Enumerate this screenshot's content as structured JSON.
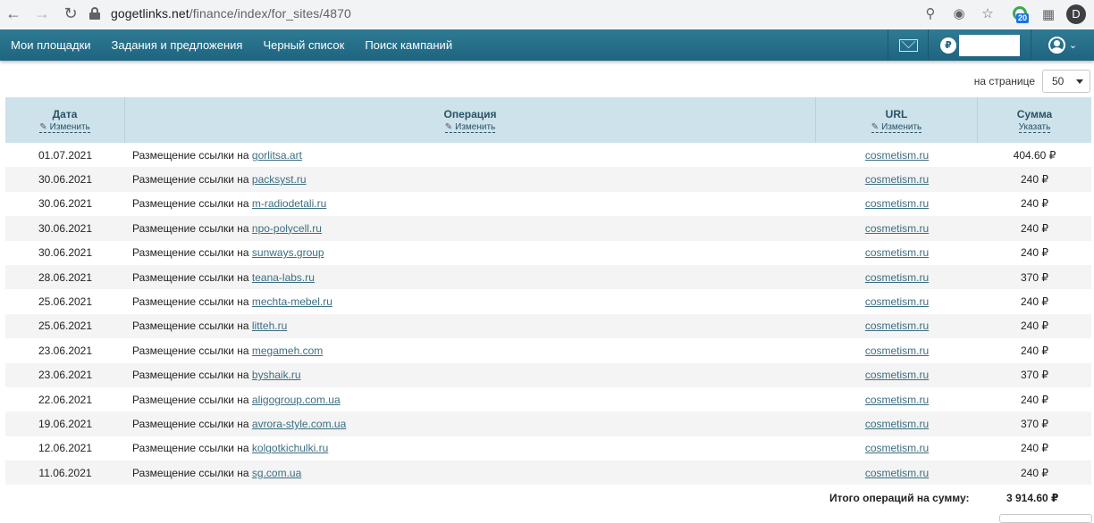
{
  "browser": {
    "url_host": "gogetlinks.net",
    "url_path": "/finance/index/for_sites/4870",
    "extension_badge": "20",
    "profile_initial": "D"
  },
  "nav": {
    "items": [
      "Мои площадки",
      "Задания и предложения",
      "Черный список",
      "Поиск кампаний"
    ],
    "currency_symbol": "₽"
  },
  "per_page": {
    "label": "на странице",
    "value": "50"
  },
  "table": {
    "headers": {
      "date": "Дата",
      "date_sub": "Изменить",
      "operation": "Операция",
      "operation_sub": "Изменить",
      "url": "URL",
      "url_sub": "Изменить",
      "sum": "Сумма",
      "sum_sub": "Указать"
    },
    "op_prefix": "Размещение ссылки на",
    "rows": [
      {
        "date": "01.07.2021",
        "site": "gorlitsa.art",
        "url": "cosmetism.ru",
        "sum": "404.60 ₽"
      },
      {
        "date": "30.06.2021",
        "site": "packsyst.ru",
        "url": "cosmetism.ru",
        "sum": "240 ₽"
      },
      {
        "date": "30.06.2021",
        "site": "m-radiodetali.ru",
        "url": "cosmetism.ru",
        "sum": "240 ₽"
      },
      {
        "date": "30.06.2021",
        "site": "npo-polycell.ru",
        "url": "cosmetism.ru",
        "sum": "240 ₽"
      },
      {
        "date": "30.06.2021",
        "site": "sunways.group",
        "url": "cosmetism.ru",
        "sum": "240 ₽"
      },
      {
        "date": "28.06.2021",
        "site": "teana-labs.ru",
        "url": "cosmetism.ru",
        "sum": "370 ₽"
      },
      {
        "date": "25.06.2021",
        "site": "mechta-mebel.ru",
        "url": "cosmetism.ru",
        "sum": "240 ₽"
      },
      {
        "date": "25.06.2021",
        "site": "litteh.ru",
        "url": "cosmetism.ru",
        "sum": "240 ₽"
      },
      {
        "date": "23.06.2021",
        "site": "megameh.com",
        "url": "cosmetism.ru",
        "sum": "240 ₽"
      },
      {
        "date": "23.06.2021",
        "site": "byshaik.ru",
        "url": "cosmetism.ru",
        "sum": "370 ₽"
      },
      {
        "date": "22.06.2021",
        "site": "aligogroup.com.ua",
        "url": "cosmetism.ru",
        "sum": "240 ₽"
      },
      {
        "date": "19.06.2021",
        "site": "avrora-style.com.ua",
        "url": "cosmetism.ru",
        "sum": "370 ₽"
      },
      {
        "date": "12.06.2021",
        "site": "kolgotkichulki.ru",
        "url": "cosmetism.ru",
        "sum": "240 ₽"
      },
      {
        "date": "11.06.2021",
        "site": "sg.com.ua",
        "url": "cosmetism.ru",
        "sum": "240 ₽"
      }
    ]
  },
  "total": {
    "label": "Итого операций на сумму:",
    "value": "3 914.60 ₽"
  }
}
